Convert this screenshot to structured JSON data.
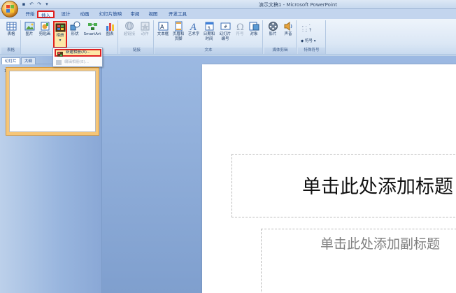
{
  "window": {
    "title": "演示文稿1 - Microsoft PowerPoint"
  },
  "tabs": [
    {
      "label": "开始"
    },
    {
      "label": "插入"
    },
    {
      "label": "设计"
    },
    {
      "label": "动画"
    },
    {
      "label": "幻灯片放映"
    },
    {
      "label": "审阅"
    },
    {
      "label": "视图"
    },
    {
      "label": "开发工具"
    }
  ],
  "ribbon": {
    "table_group": {
      "label": "表格",
      "table": "表格"
    },
    "illustrations": {
      "picture": "图片",
      "clipart": "剪贴画",
      "album": "相册",
      "shapes": "形状",
      "smartart": "SmartArt",
      "chart": "图表"
    },
    "links": {
      "label": "链接",
      "hyperlink": "超链接",
      "action": "动作"
    },
    "text": {
      "label": "文本",
      "textbox": "文本框",
      "header_footer": "页眉和\n页脚",
      "wordart": "艺术字",
      "datetime": "日期和\n时间",
      "slide_number": "幻灯片\n编号",
      "symbol": "符号",
      "object": "对象"
    },
    "media": {
      "label": "媒体剪辑",
      "movie": "影片",
      "sound": "声音"
    },
    "special": {
      "label": "特殊符号",
      "symbol_btn": "符号"
    }
  },
  "album_menu": {
    "new_album": "新建相册(A)...",
    "edit_album": "编辑相册(E)..."
  },
  "left_panel": {
    "tab_slides": "幻灯片",
    "tab_outline": "大纲",
    "close": "x",
    "slide_number": "1"
  },
  "slide": {
    "title_placeholder": "单击此处添加标题",
    "subtitle_placeholder": "单击此处添加副标题"
  },
  "colors": {
    "ribbon_bg": "#dbe7f5",
    "highlight": "#e02020",
    "menu_hover": "#fde7a6"
  }
}
